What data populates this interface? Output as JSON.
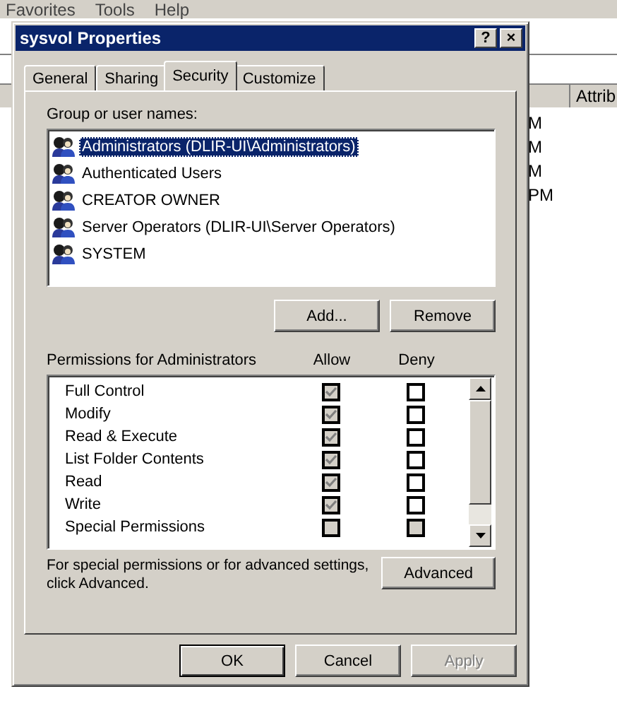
{
  "background": {
    "menu": [
      {
        "label": "Favorites"
      },
      {
        "label": "Tools"
      },
      {
        "label": "Help"
      }
    ],
    "list_column": "Attrib",
    "list_rows": [
      "M",
      "M",
      "M",
      "PM"
    ]
  },
  "window": {
    "title": "sysvol Properties",
    "help": "?",
    "close": "×"
  },
  "tabs": [
    {
      "label": "General",
      "selected": false
    },
    {
      "label": "Sharing",
      "selected": false
    },
    {
      "label": "Security",
      "selected": true
    },
    {
      "label": "Customize",
      "selected": false
    }
  ],
  "groups": {
    "label": "Group or user names:",
    "items": [
      {
        "name": "Administrators (DLIR-UI\\Administrators)",
        "selected": true
      },
      {
        "name": "Authenticated Users",
        "selected": false
      },
      {
        "name": "CREATOR OWNER",
        "selected": false
      },
      {
        "name": "Server Operators (DLIR-UI\\Server Operators)",
        "selected": false
      },
      {
        "name": "SYSTEM",
        "selected": false
      }
    ]
  },
  "group_buttons": [
    {
      "label": "Add..."
    },
    {
      "label": "Remove"
    }
  ],
  "permissions": {
    "label": "Permissions for Administrators",
    "allow_heading": "Allow",
    "deny_heading": "Deny",
    "rows": [
      {
        "name": "Full Control",
        "allow": {
          "checked": true,
          "disabled": true
        },
        "deny": {
          "checked": false,
          "disabled": false
        }
      },
      {
        "name": "Modify",
        "allow": {
          "checked": true,
          "disabled": true
        },
        "deny": {
          "checked": false,
          "disabled": false
        }
      },
      {
        "name": "Read & Execute",
        "allow": {
          "checked": true,
          "disabled": true
        },
        "deny": {
          "checked": false,
          "disabled": false
        }
      },
      {
        "name": "List Folder Contents",
        "allow": {
          "checked": true,
          "disabled": true
        },
        "deny": {
          "checked": false,
          "disabled": false
        }
      },
      {
        "name": "Read",
        "allow": {
          "checked": true,
          "disabled": true
        },
        "deny": {
          "checked": false,
          "disabled": false
        }
      },
      {
        "name": "Write",
        "allow": {
          "checked": true,
          "disabled": true
        },
        "deny": {
          "checked": false,
          "disabled": false
        }
      },
      {
        "name": "Special Permissions",
        "allow": {
          "checked": false,
          "disabled": true
        },
        "deny": {
          "checked": false,
          "disabled": true
        }
      }
    ]
  },
  "advanced": {
    "text": "For special permissions or for advanced settings, click Advanced.",
    "button": {
      "label": "Advanced"
    }
  },
  "buttons": [
    {
      "label": "OK",
      "default": true,
      "disabled": false
    },
    {
      "label": "Cancel",
      "default": false,
      "disabled": false
    },
    {
      "label": "Apply",
      "default": false,
      "disabled": true
    }
  ]
}
